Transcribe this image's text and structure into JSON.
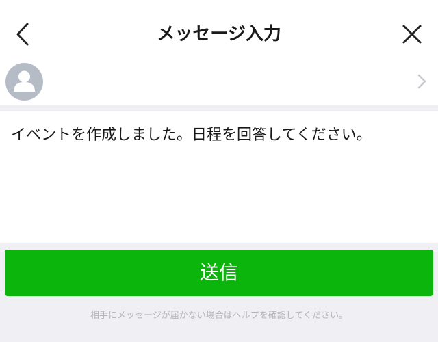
{
  "header": {
    "title": "メッセージ入力",
    "back_icon": "chevron-left-icon",
    "close_icon": "close-icon"
  },
  "recipient": {
    "avatar_icon": "person-icon",
    "chevron_icon": "chevron-right-icon"
  },
  "message": {
    "text": "イベントを作成しました。日程を回答してください。"
  },
  "send": {
    "label": "送信"
  },
  "footer": {
    "help_note": "相手にメッセージが届かない場合はヘルプを確認してください。"
  },
  "colors": {
    "accent": "#0bb50b",
    "background": "#efeff4",
    "avatar": "#b6bcc6",
    "muted_text": "#b4b4bb"
  }
}
